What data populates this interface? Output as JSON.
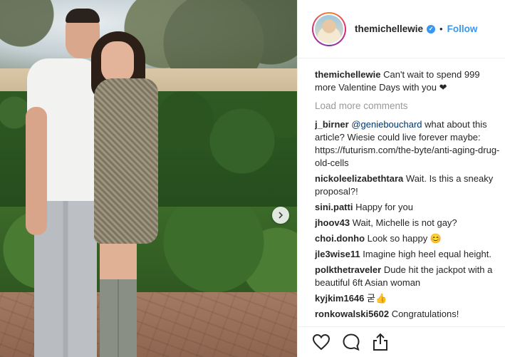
{
  "post": {
    "author": "themichellewie",
    "verified_icon": "verified-badge-icon",
    "separator": "•",
    "follow_label": "Follow",
    "caption": "Can't wait to spend 999 more Valentine Days with you ❤",
    "load_more_label": "Load more comments"
  },
  "comments": [
    {
      "user": "j_birner",
      "mention": "@geniebouchard",
      "text": " what about this article? Wiesie could live forever maybe: https://futurism.com/the-byte/anti-aging-drug-old-cells"
    },
    {
      "user": "nickoleelizabethtara",
      "mention": "",
      "text": " Wait. Is this a sneaky proposal?!"
    },
    {
      "user": "sini.patti",
      "mention": "",
      "text": " Happy for you"
    },
    {
      "user": "jhoov43",
      "mention": "",
      "text": " Wait, Michelle is not gay?"
    },
    {
      "user": "choi.donho",
      "mention": "",
      "text": " Look so happy 😊"
    },
    {
      "user": "jle3wise11",
      "mention": "",
      "text": " Imagine high heel equal height."
    },
    {
      "user": "polkthetraveler",
      "mention": "",
      "text": " Dude hit the jackpot with a beautiful 6ft Asian woman"
    },
    {
      "user": "kyjkim1646",
      "mention": "",
      "text": " 굳👍"
    },
    {
      "user": "ronkowalski5602",
      "mention": "",
      "text": " Congratulations!"
    }
  ],
  "actions": {
    "like_icon": "heart-icon",
    "comment_icon": "comment-icon",
    "share_icon": "share-icon"
  },
  "colors": {
    "link_blue": "#3897f0",
    "mention_blue": "#003569",
    "muted_gray": "#999999"
  }
}
